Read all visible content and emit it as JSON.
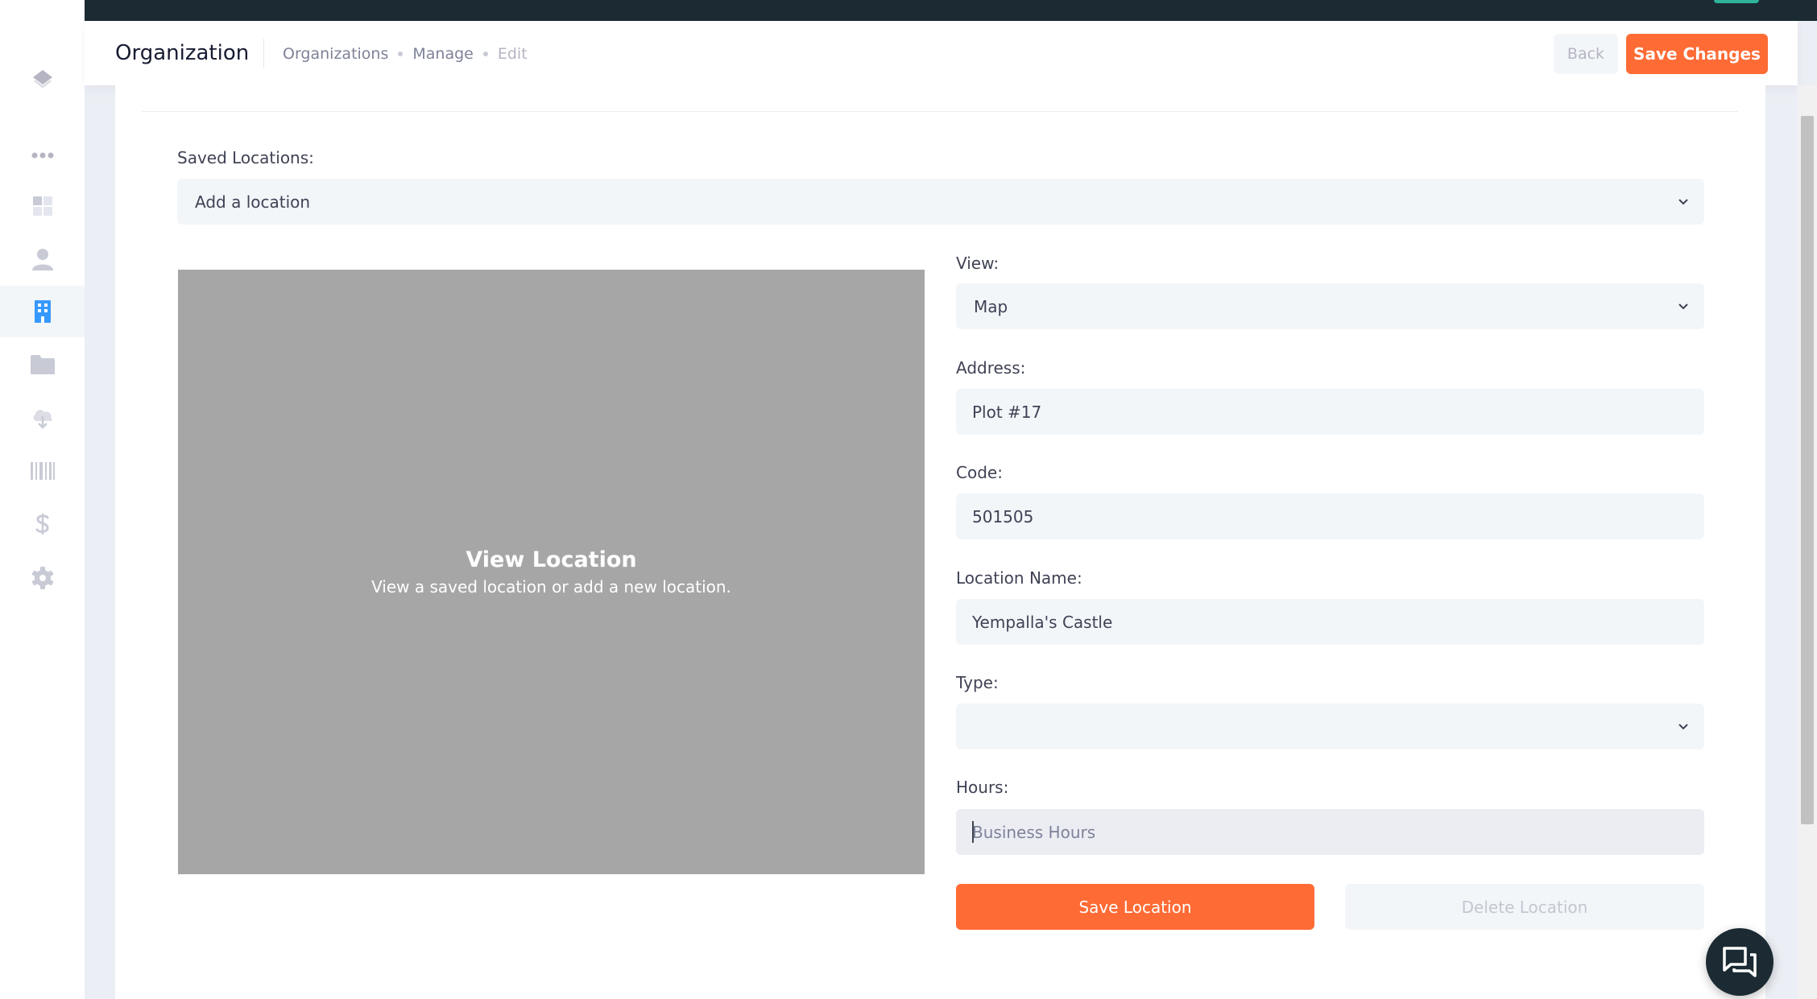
{
  "header": {
    "title": "Organization",
    "breadcrumbs": [
      "Organizations",
      "Manage",
      "Edit"
    ],
    "back_label": "Back",
    "save_changes_label": "Save Changes"
  },
  "sidebar": {
    "items": [
      {
        "name": "layers-icon",
        "active": false
      },
      {
        "name": "more-dots-icon",
        "active": false
      },
      {
        "name": "dashboard-icon",
        "active": false
      },
      {
        "name": "user-icon",
        "active": false
      },
      {
        "name": "building-icon",
        "active": true
      },
      {
        "name": "folder-icon",
        "active": false
      },
      {
        "name": "cloud-download-icon",
        "active": false
      },
      {
        "name": "barcode-icon",
        "active": false
      },
      {
        "name": "dollar-icon",
        "active": false
      },
      {
        "name": "gear-icon",
        "active": false
      }
    ],
    "active_color": "#3699ff",
    "icon_color": "#c8cbd6"
  },
  "form": {
    "saved_locations_label": "Saved Locations:",
    "saved_locations_value": "Add a location",
    "view_label": "View:",
    "view_value": "Map",
    "address_label": "Address:",
    "address_value": "Plot #17",
    "code_label": "Code:",
    "code_value": "501505",
    "location_name_label": "Location Name:",
    "location_name_value": "Yempalla's Castle",
    "type_label": "Type:",
    "type_value": "",
    "hours_label": "Hours:",
    "hours_placeholder": "Business Hours",
    "save_location_label": "Save Location",
    "delete_location_label": "Delete Location"
  },
  "map_placeholder": {
    "title": "View Location",
    "subtitle": "View a saved location or add a new location."
  },
  "colors": {
    "accent": "#ff6b35",
    "dark": "#1c2b33",
    "field_bg": "#f3f6f9"
  }
}
